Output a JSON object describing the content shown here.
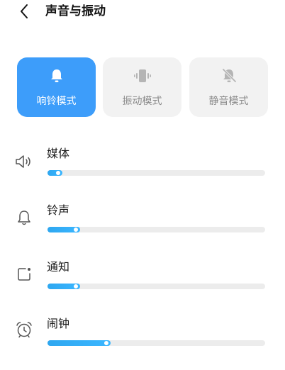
{
  "header": {
    "title": "声音与振动",
    "back_icon": "chevron-left-icon"
  },
  "modes": [
    {
      "label": "响铃模式",
      "icon": "bell-icon",
      "active": true
    },
    {
      "label": "振动模式",
      "icon": "vibrate-icon",
      "active": false
    },
    {
      "label": "静音模式",
      "icon": "bell-off-icon",
      "active": false
    }
  ],
  "volumes": [
    {
      "label": "媒体",
      "icon": "speaker-icon",
      "level": 0.07
    },
    {
      "label": "铃声",
      "icon": "bell-icon",
      "level": 0.15
    },
    {
      "label": "通知",
      "icon": "notification-icon",
      "level": 0.15
    },
    {
      "label": "闹钟",
      "icon": "alarm-clock-icon",
      "level": 0.29
    }
  ],
  "colors": {
    "accent": "#3d9dfa",
    "slider_fill": "#2ea7f0",
    "track": "#ececec",
    "card_inactive": "#f2f2f2"
  }
}
